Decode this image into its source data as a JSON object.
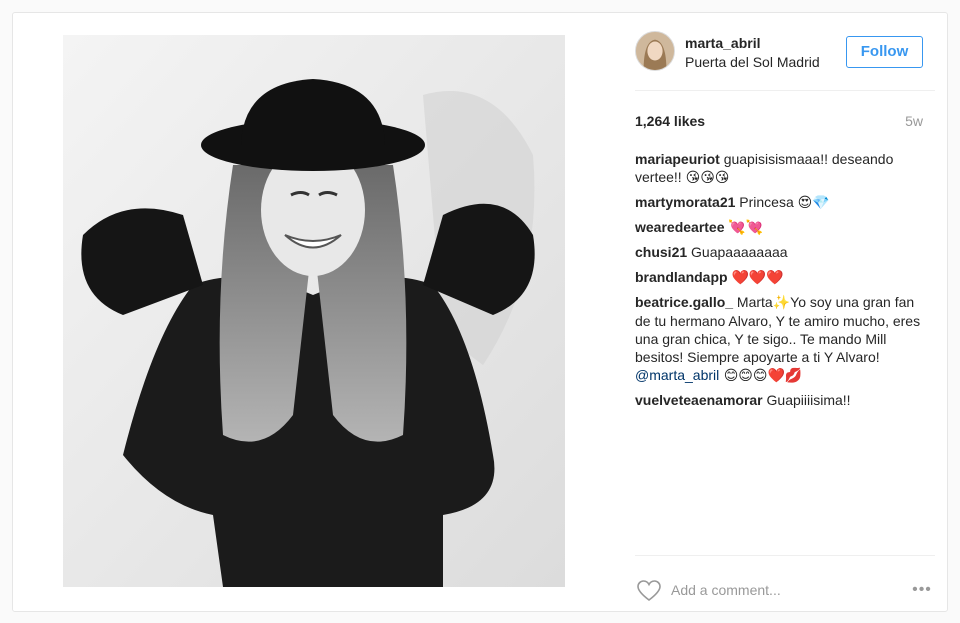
{
  "post": {
    "username": "marta_abril",
    "location": "Puerta del Sol Madrid",
    "follow_label": "Follow",
    "likes": "1,264 likes",
    "age": "5w",
    "comment_placeholder": "Add a comment...",
    "more_label": "•••"
  },
  "colors": {
    "accent": "#3897f0",
    "follow_border": "#3897f0",
    "heart_emoji": "#e0245e",
    "mention": "#003569"
  },
  "comments": [
    {
      "author": "mariapeuriot",
      "text": " guapisisismaaa!! deseando vertee!! ",
      "emoji": "😘😘😘"
    },
    {
      "author": "martymorata21",
      "text": " Princesa ",
      "emoji": "😍💎"
    },
    {
      "author": "wearedeartee",
      "text": " ",
      "emoji": "💘💘"
    },
    {
      "author": "chusi21",
      "text": " Guapaaaaaaaa",
      "emoji": ""
    },
    {
      "author": "brandlandapp",
      "text": " ",
      "emoji": "❤️❤️❤️"
    },
    {
      "author": "beatrice.gallo_",
      "text": " Marta",
      "emoji": "✨",
      "text2": "Yo soy una gran fan de tu hermano Alvaro, Y te amiro mucho, eres una gran chica, Y te sigo.. Te mando Mill besitos! Siempre apoyarte a ti Y Alvaro! ",
      "mention": "@marta_abril",
      "emoji2": " 😊😊😊❤️💋"
    },
    {
      "author": "vuelveteaenamorar",
      "text": " Guapiiiisima!!",
      "emoji": ""
    }
  ],
  "icons": {
    "heart": "heart-outline-icon",
    "more": "more-options-icon"
  }
}
